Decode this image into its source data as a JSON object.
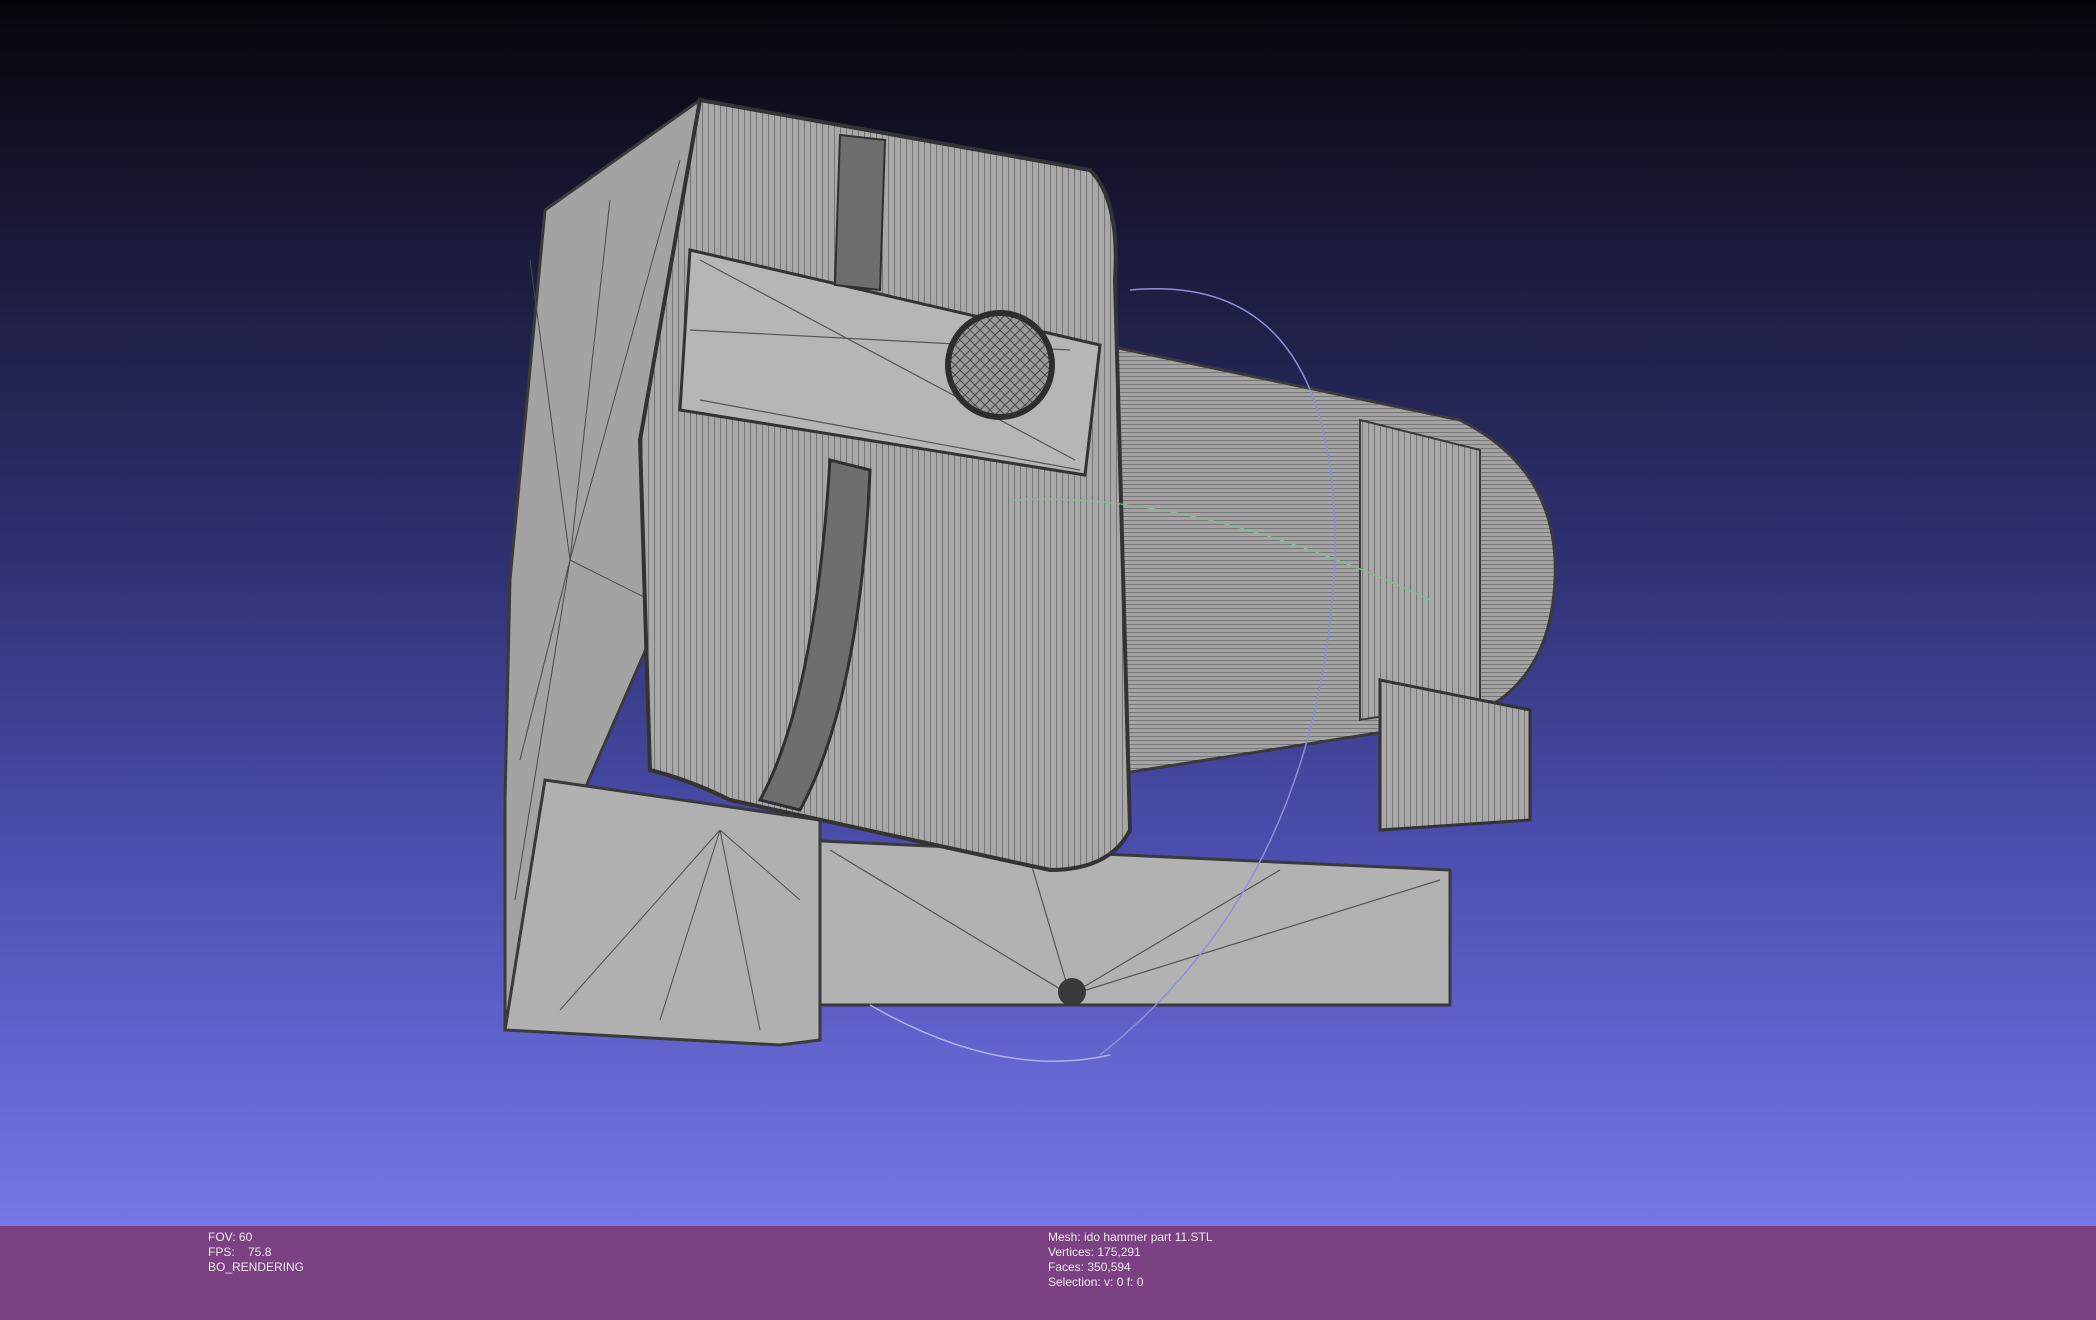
{
  "viewport": {
    "background_top": "#05050a",
    "background_bottom": "#7676e8",
    "mesh_color": "#a9a9a9",
    "edge_color": "#3a3a3a"
  },
  "info": {
    "left": {
      "fov": "FOV: 60",
      "fps": "FPS:    75.8",
      "mode": "BO_RENDERING"
    },
    "mesh": {
      "name": "Mesh: ido hammer part 11.STL",
      "vertices": "Vertices: 175,291",
      "faces": "Faces: 350,594",
      "selection": "Selection: v: 0 f: 0"
    }
  }
}
